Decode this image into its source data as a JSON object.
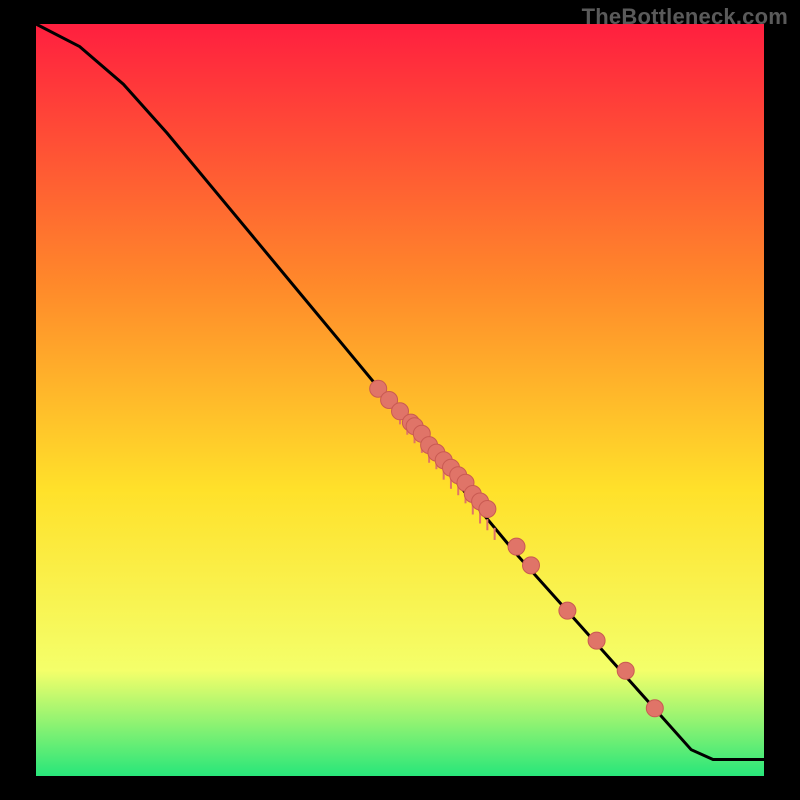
{
  "watermark": "TheBottleneck.com",
  "colors": {
    "page_bg": "#000000",
    "gradient_top": "#ff1f3f",
    "gradient_mid1": "#ff8a2a",
    "gradient_mid2": "#ffe12a",
    "gradient_mid3": "#f4ff6a",
    "gradient_bottom": "#28e67a",
    "curve": "#000000",
    "marker_fill": "#e07468",
    "marker_stroke": "#c95a52"
  },
  "chart_data": {
    "type": "line",
    "title": "",
    "xlabel": "",
    "ylabel": "",
    "xlim": [
      0,
      100
    ],
    "ylim": [
      0,
      100
    ],
    "series": [
      {
        "name": "curve",
        "x": [
          0,
          6,
          12,
          18,
          24,
          30,
          36,
          42,
          48,
          54,
          60,
          66,
          72,
          78,
          84,
          90,
          93,
          100
        ],
        "y": [
          100,
          97,
          92,
          85.5,
          78.5,
          71.5,
          64.5,
          57.5,
          50.5,
          43.5,
          36.5,
          29.5,
          23,
          16.5,
          10,
          3.5,
          2.2,
          2.2
        ]
      }
    ],
    "markers": {
      "name": "highlighted-points",
      "x": [
        47,
        48.5,
        50,
        51.5,
        52,
        53,
        54,
        55,
        56,
        57,
        58,
        59,
        60,
        61,
        62,
        66,
        68,
        73,
        77,
        81,
        85
      ],
      "y": [
        51.5,
        50,
        48.5,
        47,
        46.5,
        45.5,
        44,
        43,
        42,
        41,
        40,
        39,
        37.5,
        36.5,
        35.5,
        30.5,
        28,
        22,
        18,
        14,
        9
      ]
    }
  }
}
